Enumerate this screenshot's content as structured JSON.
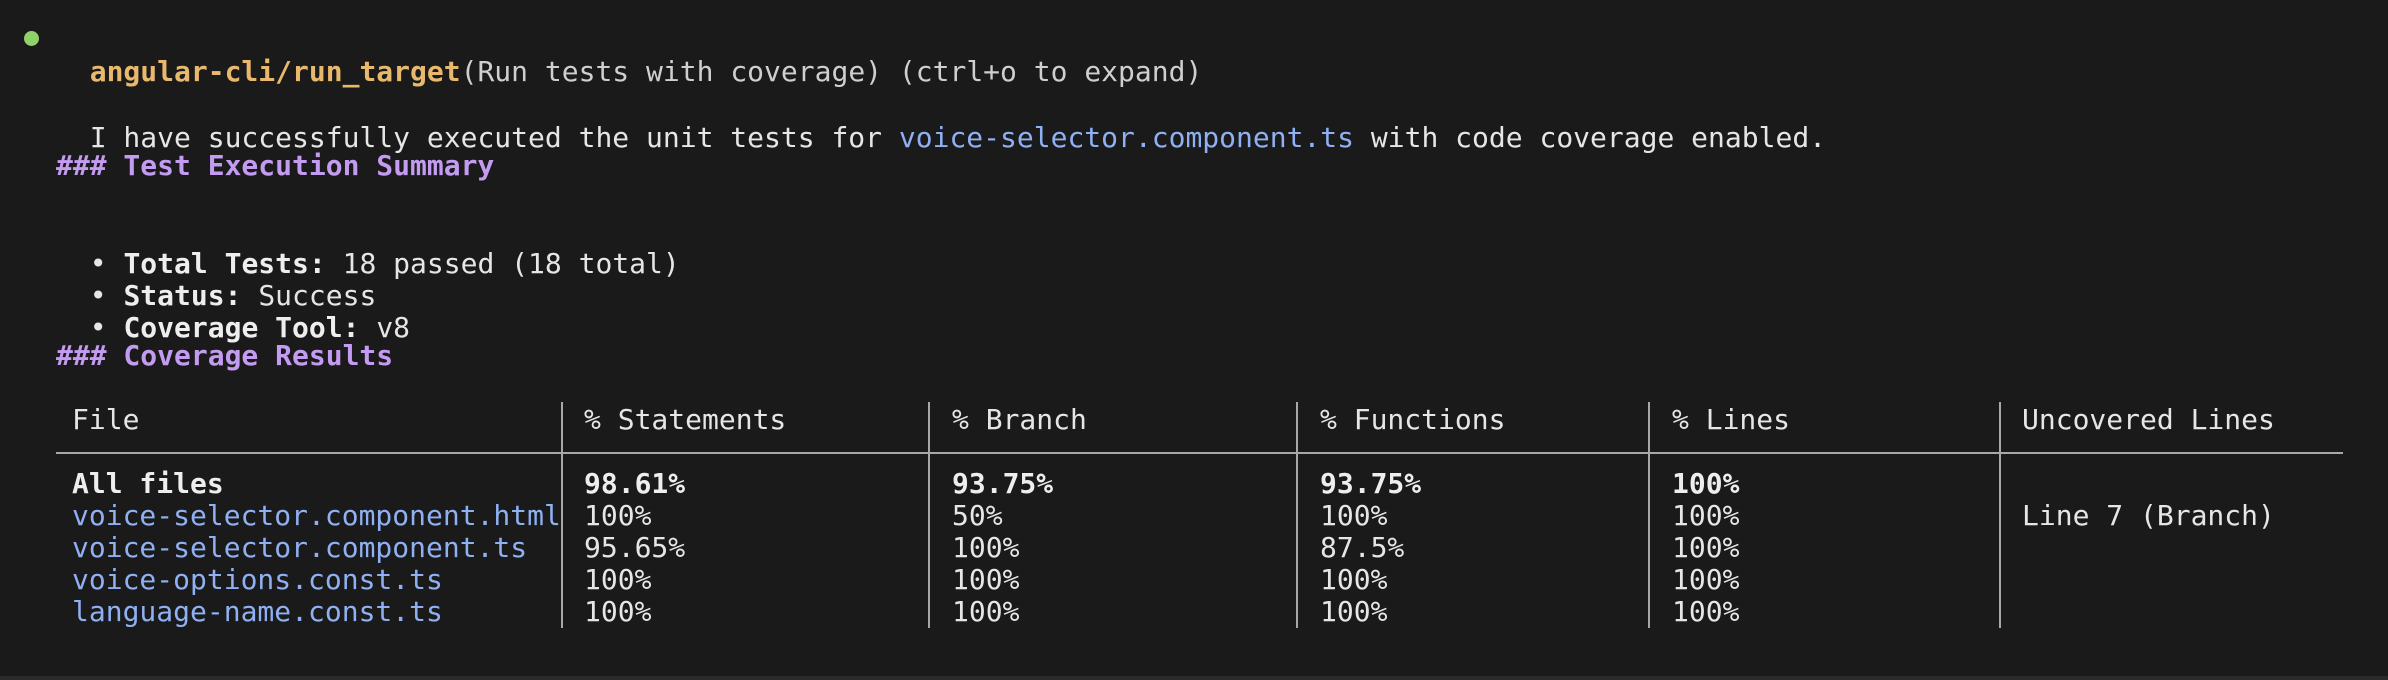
{
  "tool_call": {
    "name": "angular-cli/run_target",
    "args": "(Run tests with coverage)",
    "hint": "(ctrl+o to expand)"
  },
  "message": {
    "prefix": "I have successfully executed the unit tests for ",
    "file_link": "voice-selector.component.ts",
    "suffix": " with code coverage enabled."
  },
  "summary": {
    "heading": "### Test Execution Summary",
    "items": [
      {
        "label": "Total Tests:",
        "value": "18 passed (18 total)"
      },
      {
        "label": "Status:",
        "value": "Success"
      },
      {
        "label": "Coverage Tool:",
        "value": "v8"
      }
    ],
    "bullet": "•"
  },
  "coverage": {
    "heading": "### Coverage Results",
    "columns": [
      "File",
      "% Statements",
      "% Branch",
      "% Functions",
      "% Lines",
      "Uncovered Lines"
    ],
    "rows": [
      {
        "file": "All files",
        "statements": "98.61%",
        "branch": "93.75%",
        "functions": "93.75%",
        "lines": "100%",
        "uncovered": ""
      },
      {
        "file": "voice-selector.component.html",
        "statements": "100%",
        "branch": "50%",
        "functions": "100%",
        "lines": "100%",
        "uncovered": "Line 7 (Branch)"
      },
      {
        "file": "voice-selector.component.ts",
        "statements": "95.65%",
        "branch": "100%",
        "functions": "87.5%",
        "lines": "100%",
        "uncovered": ""
      },
      {
        "file": "voice-options.const.ts",
        "statements": "100%",
        "branch": "100%",
        "functions": "100%",
        "lines": "100%",
        "uncovered": ""
      },
      {
        "file": "language-name.const.ts",
        "statements": "100%",
        "branch": "100%",
        "functions": "100%",
        "lines": "100%",
        "uncovered": ""
      }
    ]
  },
  "colors": {
    "background": "#1a1a1a",
    "tool_name": "#e8b86c",
    "link": "#8fb0f2",
    "heading": "#c39bf0",
    "status_dot": "#8fd16a"
  }
}
